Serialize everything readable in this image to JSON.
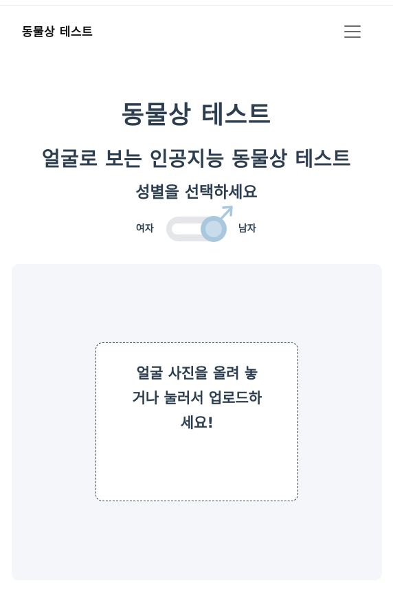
{
  "navbar": {
    "brand": "동물상 테스트",
    "menu_icon": "hamburger-menu-icon"
  },
  "main": {
    "title": "동물상 테스트",
    "subtitle": "얼굴로 보는 인공지능 동물상 테스트",
    "gender_prompt": "성별을 선택하세요",
    "gender_toggle": {
      "left_label": "여자",
      "right_label": "남자",
      "selected": "남자",
      "icon": "male-symbol-icon"
    }
  },
  "upload": {
    "prompt": "얼굴 사진을 올려 놓거나 눌러서 업로드하세요!"
  },
  "colors": {
    "text": "#2c3e50",
    "toggle_track": "#e4e6e9",
    "toggle_knob": "#a9c8de",
    "upload_bg": "#f5f6f9"
  }
}
